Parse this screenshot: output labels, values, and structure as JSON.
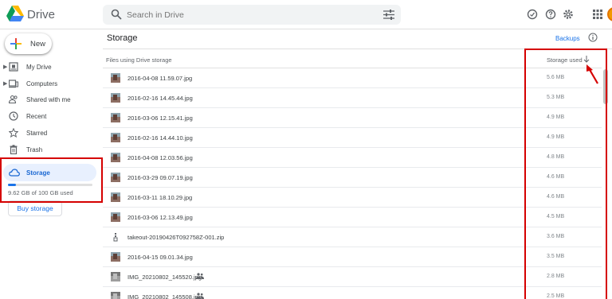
{
  "header": {
    "app_name": "Drive",
    "search_placeholder": "Search in Drive"
  },
  "sidebar": {
    "new_label": "New",
    "items": [
      {
        "label": "My Drive",
        "icon": "my-drive-icon",
        "expandable": true
      },
      {
        "label": "Computers",
        "icon": "computers-icon",
        "expandable": true
      },
      {
        "label": "Shared with me",
        "icon": "shared-with-me-icon",
        "expandable": false
      },
      {
        "label": "Recent",
        "icon": "clock-icon",
        "expandable": false
      },
      {
        "label": "Starred",
        "icon": "star-icon",
        "expandable": false
      },
      {
        "label": "Trash",
        "icon": "trash-icon",
        "expandable": false
      }
    ],
    "storage": {
      "label": "Storage",
      "usage_text": "9.62 GB of 100 GB used",
      "used_fraction": 0.0962,
      "buy_label": "Buy storage"
    }
  },
  "main": {
    "title": "Storage",
    "backups_label": "Backups",
    "columns": {
      "files": "Files using Drive storage",
      "storage_used": "Storage used"
    },
    "rows": [
      {
        "name": "2016-04-08 11.59.07.jpg",
        "size": "5.6 MB",
        "type": "image",
        "shared": false
      },
      {
        "name": "2016-02-16 14.45.44.jpg",
        "size": "5.3 MB",
        "type": "image",
        "shared": false
      },
      {
        "name": "2016-03-06 12.15.41.jpg",
        "size": "4.9 MB",
        "type": "image",
        "shared": false
      },
      {
        "name": "2016-02-16 14.44.10.jpg",
        "size": "4.9 MB",
        "type": "image",
        "shared": false
      },
      {
        "name": "2016-04-08 12.03.56.jpg",
        "size": "4.8 MB",
        "type": "image",
        "shared": false
      },
      {
        "name": "2016-03-29 09.07.19.jpg",
        "size": "4.6 MB",
        "type": "image",
        "shared": false
      },
      {
        "name": "2016-03-11 18.10.29.jpg",
        "size": "4.6 MB",
        "type": "image",
        "shared": false
      },
      {
        "name": "2016-03-06 12.13.49.jpg",
        "size": "4.5 MB",
        "type": "image",
        "shared": false
      },
      {
        "name": "takeout-20190426T092758Z-001.zip",
        "size": "3.6 MB",
        "type": "zip",
        "shared": false
      },
      {
        "name": "2016-04-15 09.01.34.jpg",
        "size": "3.5 MB",
        "type": "image",
        "shared": false
      },
      {
        "name": "IMG_20210802_145520.jpg",
        "size": "2.8 MB",
        "type": "image-gray",
        "shared": true
      },
      {
        "name": "IMG_20210802_145508.jpg",
        "size": "2.5 MB",
        "type": "image-gray",
        "shared": true
      }
    ]
  },
  "colors": {
    "accent": "#1a73e8",
    "annotation_red": "#d50000",
    "active_nav_bg": "#e8f0fe"
  }
}
